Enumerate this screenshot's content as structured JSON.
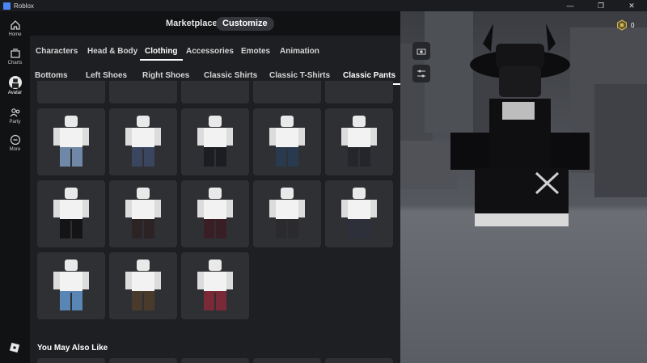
{
  "window": {
    "title": "Roblox",
    "controls": [
      "—",
      "❐",
      "✕"
    ]
  },
  "leftnav": {
    "items": [
      {
        "label": "Home",
        "icon": "home-icon"
      },
      {
        "label": "Charts",
        "icon": "charts-icon"
      },
      {
        "label": "Avatar",
        "icon": "avatar-icon",
        "active": true
      },
      {
        "label": "Party",
        "icon": "party-icon"
      },
      {
        "label": "More",
        "icon": "more-icon"
      }
    ],
    "bottom_icon": "roblox-logo-icon"
  },
  "topnav": {
    "marketplace": "Marketplace",
    "customize": "Customize",
    "active": "Customize"
  },
  "category_tabs": [
    "Characters",
    "Head & Body",
    "Clothing",
    "Accessories",
    "Emotes",
    "Animation"
  ],
  "category_active": "Clothing",
  "subcategory_tabs": [
    "Bottoms",
    "Left Shoes",
    "Right Shoes",
    "Classic Shirts",
    "Classic T-Shirts",
    "Classic Pants"
  ],
  "subcategory_active": "Classic Pants",
  "grid_items": [
    {
      "name": "pants-item",
      "pants": "#6f88a8"
    },
    {
      "name": "pants-item",
      "pants": "#3a4660"
    },
    {
      "name": "pants-item",
      "pants": "#1c1d22"
    },
    {
      "name": "pants-item",
      "pants": "#2a3a4e"
    },
    {
      "name": "pants-item",
      "pants": "#25262b"
    },
    {
      "name": "pants-item",
      "pants": "#141416"
    },
    {
      "name": "pants-item",
      "pants": "#2c2325"
    },
    {
      "name": "pants-item",
      "pants": "#3a1e25"
    },
    {
      "name": "pants-item",
      "pants": "#2b2b2e"
    },
    {
      "name": "pants-item",
      "pants": "#2d2f3a"
    },
    {
      "name": "pants-item",
      "pants": "#5a86b5"
    },
    {
      "name": "pants-item",
      "pants": "#4a3a2c"
    },
    {
      "name": "pants-item",
      "pants": "#7a2a36"
    }
  ],
  "section_title": "You May Also Like",
  "robux": {
    "amount": "0",
    "icon": "robux-icon"
  },
  "scene_tools": [
    "camera-icon",
    "adjust-sliders-icon"
  ],
  "colors": {
    "accent": "#ffffff",
    "panel": "#1e1f22",
    "card": "#2f3034",
    "pill": "#34363c"
  }
}
